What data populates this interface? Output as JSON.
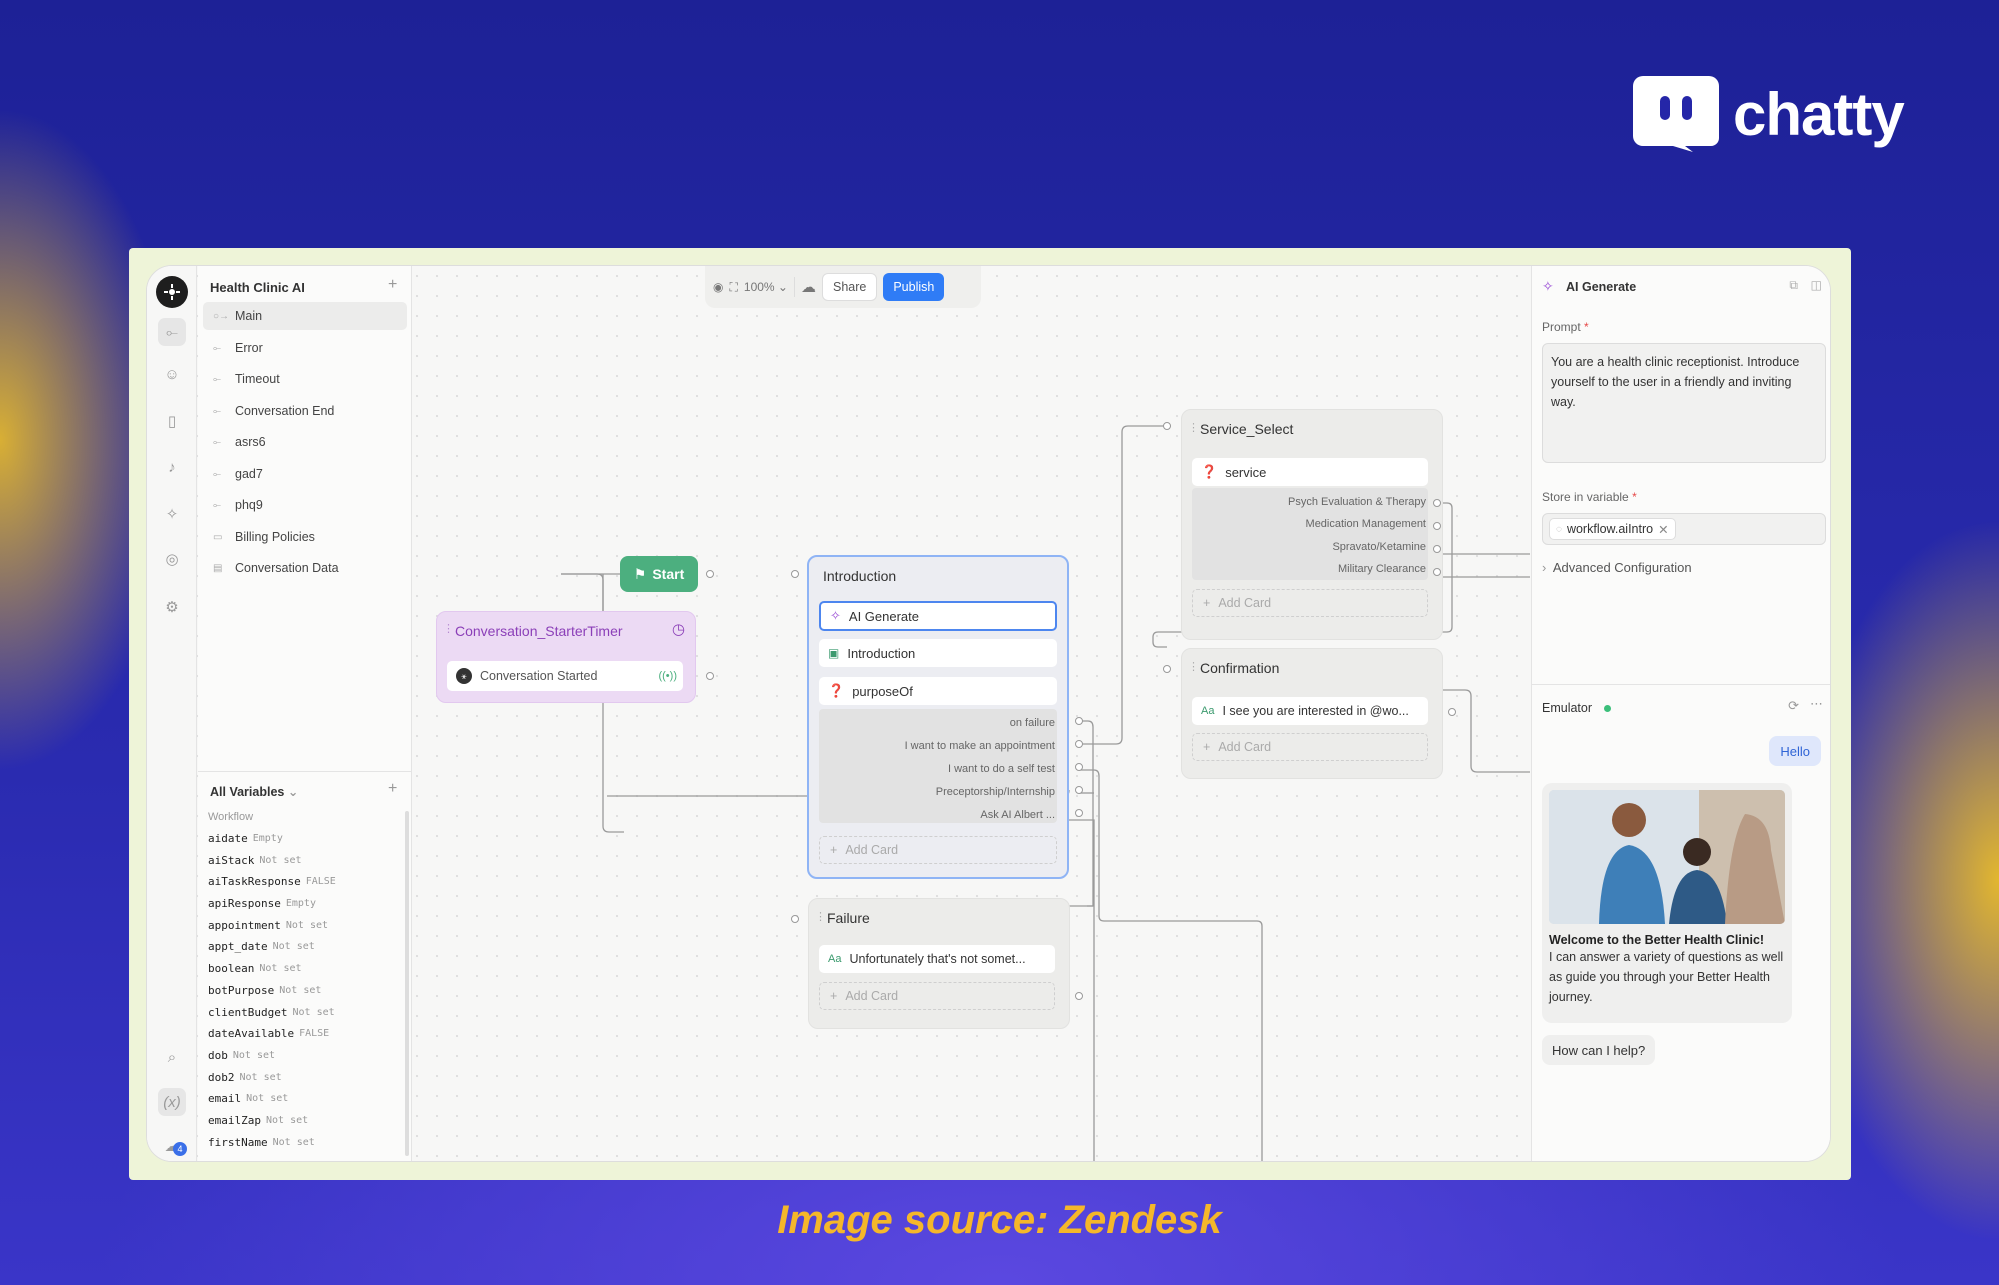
{
  "brand": {
    "name": "chatty"
  },
  "caption": "Image source: Zendesk",
  "sidebar": {
    "title": "Health Clinic AI",
    "flows": [
      "Main",
      "Error",
      "Timeout",
      "Conversation End",
      "asrs6",
      "gad7",
      "phq9",
      "Billing Policies",
      "Conversation Data"
    ]
  },
  "variables": {
    "title": "All Variables",
    "section": "Workflow",
    "items": [
      {
        "name": "aidate",
        "value": "Empty"
      },
      {
        "name": "aiStack",
        "value": "Not set"
      },
      {
        "name": "aiTaskResponse",
        "value": "FALSE"
      },
      {
        "name": "apiResponse",
        "value": "Empty"
      },
      {
        "name": "appointment",
        "value": "Not set"
      },
      {
        "name": "appt_date",
        "value": "Not set"
      },
      {
        "name": "boolean",
        "value": "Not set"
      },
      {
        "name": "botPurpose",
        "value": "Not set"
      },
      {
        "name": "clientBudget",
        "value": "Not set"
      },
      {
        "name": "dateAvailable",
        "value": "FALSE"
      },
      {
        "name": "dob",
        "value": "Not set"
      },
      {
        "name": "dob2",
        "value": "Not set"
      },
      {
        "name": "email",
        "value": "Not set"
      },
      {
        "name": "emailZap",
        "value": "Not set"
      },
      {
        "name": "firstName",
        "value": "Not set"
      }
    ]
  },
  "rail": {
    "badge": "4"
  },
  "toolbar": {
    "zoom": "100%",
    "share": "Share",
    "publish": "Publish"
  },
  "canvas": {
    "start": "Start",
    "timer": {
      "title": "Conversation_StarterTimer",
      "card": "Conversation Started"
    },
    "intro": {
      "title": "Introduction",
      "cards": [
        "AI Generate",
        "Introduction",
        "purposeOf"
      ],
      "paths": [
        "on failure",
        "I want to make an appointment",
        "I want to do a self test",
        "Preceptorship/Internship",
        "Ask AI Albert ..."
      ],
      "add": "Add Card"
    },
    "service": {
      "title": "Service_Select",
      "card": "service",
      "paths": [
        "Psych Evaluation & Therapy",
        "Medication Management",
        "Spravato/Ketamine",
        "Military Clearance"
      ],
      "add": "Add Card"
    },
    "confirmation": {
      "title": "Confirmation",
      "card": "I see you are interested in @wo...",
      "add": "Add Card"
    },
    "failure": {
      "title": "Failure",
      "card": "Unfortunately that's not somet...",
      "add": "Add Card"
    }
  },
  "editor": {
    "title": "AI Generate",
    "prompt_label": "Prompt",
    "prompt": "You are a health clinic receptionist. Introduce yourself to the user in a friendly and inviting way.",
    "store_label": "Store in variable",
    "variable": "workflow.aiIntro",
    "advanced": "Advanced Configuration"
  },
  "emulator": {
    "title": "Emulator",
    "user_msg": "Hello",
    "bot_title": "Welcome to the Better Health Clinic!",
    "bot_body": "I can answer a variety of questions as well as guide you through your Better Health journey.",
    "bot_msg2": "How can I help?"
  },
  "colors": {
    "accent": "#2f7cf6",
    "start": "#4caf7f",
    "timer": "#ecdaf4",
    "caption": "#f5b72a"
  }
}
